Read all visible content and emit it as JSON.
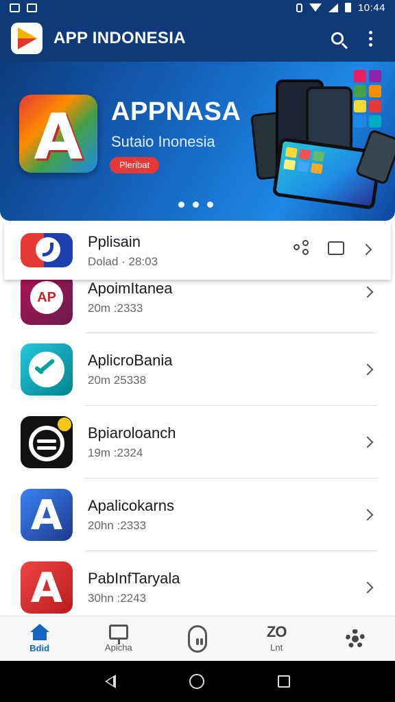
{
  "status_bar": {
    "time": "10:44",
    "icons": [
      "gallery-icon",
      "image-icon",
      "vibrate-icon",
      "wifi-icon",
      "signal-icon",
      "battery-icon"
    ]
  },
  "app_bar": {
    "title": "APP INDONESIA",
    "actions": [
      "search-icon",
      "more-icon"
    ],
    "color": "#0f3a78"
  },
  "banner": {
    "title": "APPNASA",
    "subtitle": "Sutaio Inonesia",
    "cta": "Pleribat",
    "carousel_dots": 3
  },
  "apps": [
    {
      "name": "Pplisain",
      "meta": "Dolad · 28:03",
      "icon": "app-icon-red-blue"
    },
    {
      "name": "ApoimItanea",
      "meta": "20m :2333",
      "icon": "app-icon-ap"
    },
    {
      "name": "AplicroBania",
      "meta": "20m 25338",
      "icon": "app-icon-teal-arrow"
    },
    {
      "name": "Bpiaroloanch",
      "meta": "19m :2324",
      "icon": "app-icon-black-circle"
    },
    {
      "name": "Apalicokarns",
      "meta": "20hn :2333",
      "icon": "app-icon-blue-a"
    },
    {
      "name": "PabInfTaryala",
      "meta": "30hn :2243",
      "icon": "app-icon-red-a"
    }
  ],
  "bottom_nav": {
    "items": [
      {
        "label": "Bdid",
        "icon": "home-icon",
        "active": true
      },
      {
        "label": "Apicha",
        "icon": "flag-icon",
        "active": false
      },
      {
        "label": "",
        "icon": "robot-icon",
        "active": false
      },
      {
        "label": "Lnt",
        "icon": "zo-icon",
        "active": false
      },
      {
        "label": "",
        "icon": "settings-icon",
        "active": false
      }
    ],
    "active_color": "#1565c0"
  }
}
